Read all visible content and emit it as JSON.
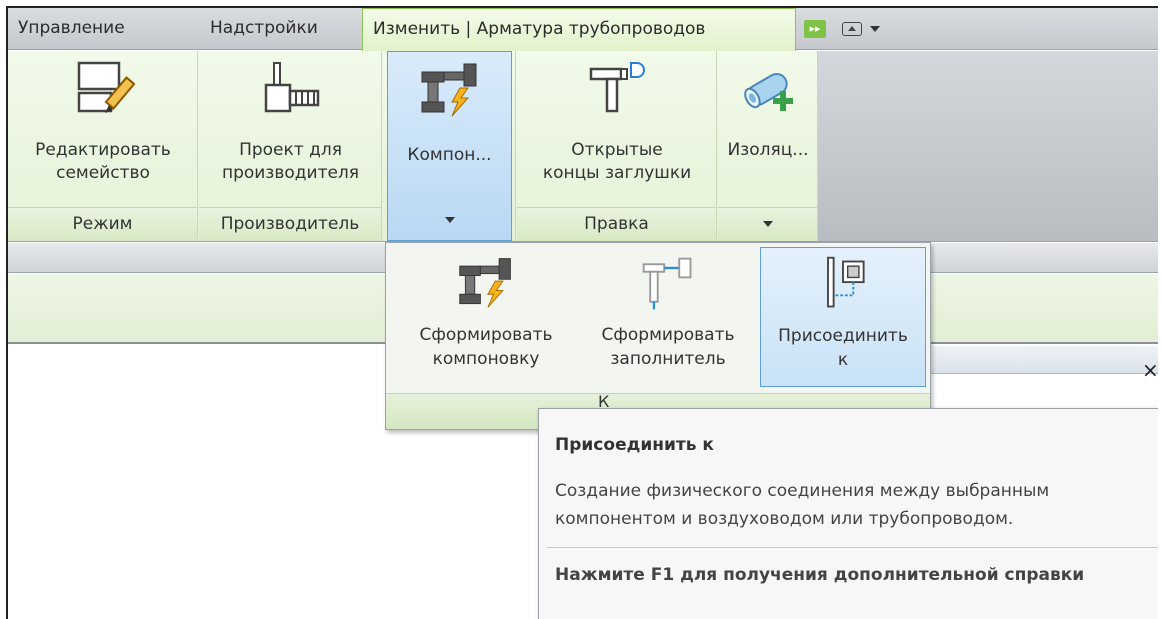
{
  "tabs": [
    {
      "label": "Управление",
      "active": false
    },
    {
      "label": "Надстройки",
      "active": false
    },
    {
      "label": "Изменить | Арматура трубопроводов",
      "active": true
    }
  ],
  "ribbon": {
    "panels": {
      "mode": {
        "title": "Режим",
        "command": "Редактировать\nсемейство",
        "icon": "edit-family-icon"
      },
      "manufacturer": {
        "title": "Производитель",
        "command": "Проект для\nпроизводителя",
        "icon": "manufacturer-design-icon"
      },
      "layout": {
        "command": "Компон...",
        "icon": "generate-layout-icon"
      },
      "edit": {
        "title": "Правка",
        "command": "Открытые\nконцы заглушки",
        "icon": "cap-open-ends-icon"
      },
      "insulation": {
        "command": "Изоляц...",
        "icon": "add-insulation-icon"
      }
    }
  },
  "dropdown": {
    "items": [
      {
        "label": "Сформировать\nкомпоновку",
        "icon": "generate-layout-icon",
        "active": false
      },
      {
        "label": "Сформировать\nзаполнитель",
        "icon": "generate-placeholder-icon",
        "active": false
      },
      {
        "label": "Присоединить\nк",
        "icon": "connect-into-icon",
        "active": true
      }
    ],
    "footer_partial": "К"
  },
  "close_label": "×",
  "tooltip": {
    "title": "Присоединить к",
    "description": "Создание физического соединения между выбранным компонентом и воздуховодом или трубопроводом.",
    "help": "Нажмите F1 для получения дополнительной справки"
  },
  "colors": {
    "ribbon_green": "#e4f1d6",
    "active_tab_border": "#8cc257",
    "selection_blue": "#5f9fd3"
  }
}
